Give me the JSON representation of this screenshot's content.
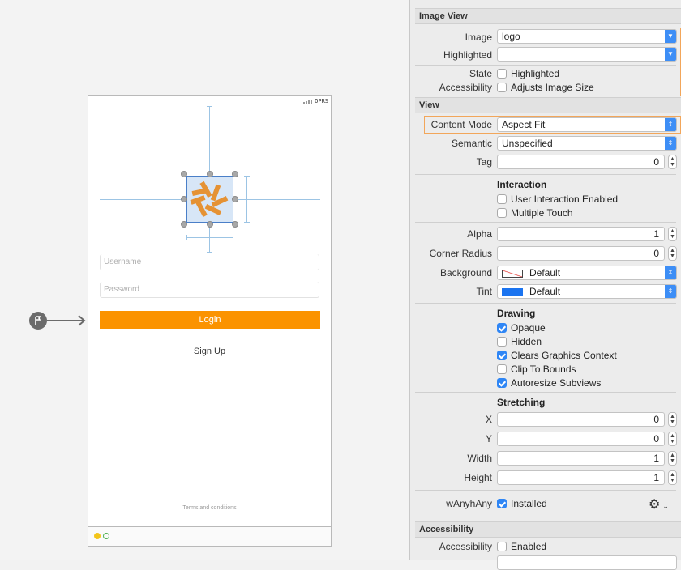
{
  "phone": {
    "status_carrier": "OPRS",
    "username_placeholder": "Username",
    "password_placeholder": "Password",
    "login_label": "Login",
    "signup_label": "Sign Up",
    "terms_label": "Terms and conditions"
  },
  "inspector": {
    "image_view": {
      "header": "Image View",
      "image_label": "Image",
      "image_value": "logo",
      "highlighted_label": "Highlighted",
      "highlighted_value": "",
      "state_label": "State",
      "state_option": "Highlighted",
      "accessibility_label": "Accessibility",
      "accessibility_option": "Adjusts Image Size"
    },
    "view": {
      "header": "View",
      "content_mode_label": "Content Mode",
      "content_mode_value": "Aspect Fit",
      "semantic_label": "Semantic",
      "semantic_value": "Unspecified",
      "tag_label": "Tag",
      "tag_value": "0",
      "interaction_title": "Interaction",
      "user_interaction": "User Interaction Enabled",
      "multiple_touch": "Multiple Touch",
      "alpha_label": "Alpha",
      "alpha_value": "1",
      "corner_label": "Corner Radius",
      "corner_value": "0",
      "background_label": "Background",
      "background_value": "Default",
      "tint_label": "Tint",
      "tint_value": "Default",
      "drawing_title": "Drawing",
      "opaque": "Opaque",
      "hidden": "Hidden",
      "clears": "Clears Graphics Context",
      "clip": "Clip To Bounds",
      "autoresize": "Autoresize Subviews",
      "stretching_title": "Stretching",
      "x_label": "X",
      "x_value": "0",
      "y_label": "Y",
      "y_value": "0",
      "width_label": "Width",
      "width_value": "1",
      "height_label": "Height",
      "height_value": "1",
      "trait_label": "wAnyhAny",
      "installed": "Installed"
    },
    "accessibility": {
      "header": "Accessibility",
      "label": "Accessibility",
      "enabled": "Enabled"
    }
  },
  "colors": {
    "accent": "#fb9300",
    "tint": "#1b74f0",
    "checkbox": "#2f86f5"
  },
  "checked": {
    "opaque": true,
    "clears": true,
    "autoresize": true,
    "installed": true
  }
}
